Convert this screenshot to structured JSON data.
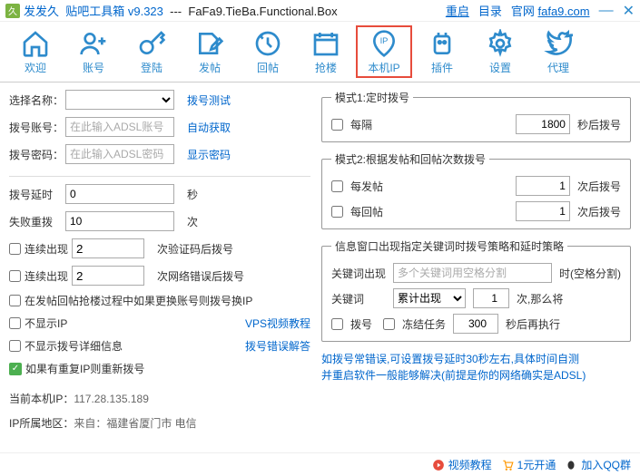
{
  "title": {
    "app": "发发久",
    "name": "贴吧工具箱 v9.323",
    "sep": "---",
    "eng": "FaFa9.TieBa.Functional.Box",
    "reset": "重启",
    "catalog": "目录",
    "site_label": "官网",
    "site": "fafa9.com"
  },
  "toolbar": {
    "welcome": "欢迎",
    "account": "账号",
    "login": "登陆",
    "post": "发帖",
    "reply": "回帖",
    "grab": "抢楼",
    "ip": "本机IP",
    "plugin": "插件",
    "setting": "设置",
    "proxy": "代理"
  },
  "left": {
    "name_label": "选择名称：",
    "dial_test": "拨号测试",
    "acct_label": "拨号账号：",
    "acct_ph": "在此输入ADSL账号",
    "auto_get": "自动获取",
    "pwd_label": "拨号密码：",
    "pwd_ph": "在此输入ADSL密码",
    "show_pwd": "显示密码",
    "delay_label": "拨号延时",
    "delay_val": "0",
    "sec": "秒",
    "fail_label": "失败重拨",
    "fail_val": "10",
    "times": "次",
    "cont1_label": "连续出现",
    "cont1_val": "2",
    "cont1_suffix": "次验证码后拨号",
    "cont2_label": "连续出现",
    "cont2_val": "2",
    "cont2_suffix": "次网络错误后拨号",
    "swap_ip": "在发帖回帖抢楼过程中如果更换账号则拨号换IP",
    "hide_ip": "不显示IP",
    "vps_tut": "VPS视频教程",
    "hide_detail": "不显示拨号详细信息",
    "dial_err": "拨号错误解答",
    "dup_redial": "如果有重复IP则重新拨号",
    "cur_ip_label": "当前本机IP：",
    "cur_ip": "117.28.135.189",
    "loc_label": "IP所属地区：",
    "loc": "来自：福建省厦门市 电信"
  },
  "mode1": {
    "legend": "模式1:定时拨号",
    "interval": "每隔",
    "interval_val": "1800",
    "after": "秒后拨号"
  },
  "mode2": {
    "legend": "模式2:根据发帖和回帖次数拨号",
    "post": "每发帖",
    "post_val": "1",
    "reply": "每回帖",
    "reply_val": "1",
    "after": "次后拨号"
  },
  "info": {
    "legend": "信息窗口出现指定关键词时拨号策略和延时策略",
    "kw_appear": "关键词出现",
    "kw_ph": "多个关键词用空格分割",
    "time_split": "时(空格分割)",
    "kw": "关键词",
    "sum_opt": "累计出现",
    "kw_val": "1",
    "then": "次,那么将",
    "dial": "拨号",
    "freeze": "冻结任务",
    "freeze_val": "300",
    "re_exec": "秒后再执行"
  },
  "note": {
    "l1": "如拨号常错误,可设置拨号延时30秒左右,具体时间自测",
    "l2": "并重启软件一般能够解决(前提是你的网络确实是ADSL)"
  },
  "footer": {
    "video": "视频教程",
    "buy": "1元开通",
    "qq": "加入QQ群"
  }
}
